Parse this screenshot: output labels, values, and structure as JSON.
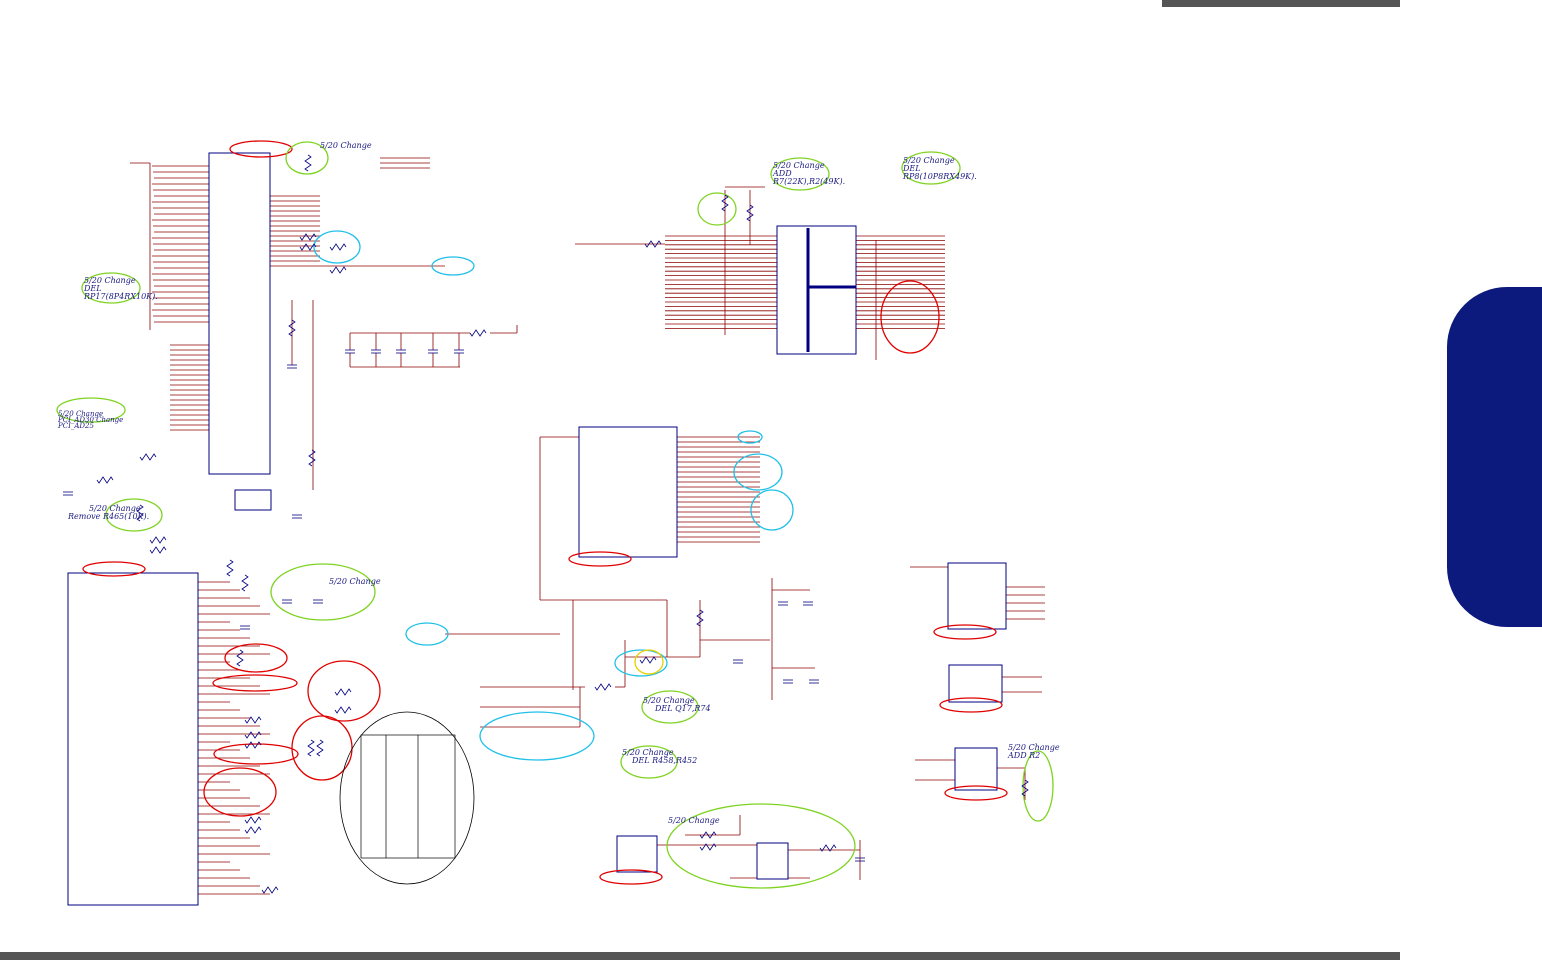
{
  "colors": {
    "wire": "#8b0000",
    "box": "#000080",
    "circle_red": "#e00000",
    "circle_green": "#7ed321",
    "circle_cyan": "#20c0e8",
    "circle_yellow": "#e8d000",
    "note": "#1a1a80",
    "side_tab": "#0d1a7d",
    "bar": "#555555"
  },
  "notes": {
    "n1": "5/20 Change",
    "n2a": "5/20 Change",
    "n2b": "ADD",
    "n2c": "R7(22K),R2(49K).",
    "n3a": "5/20 Change",
    "n3b": "DEL",
    "n3c": "RP8(10P8RX49K).",
    "n4a": "5/20 Change",
    "n4b": "DEL",
    "n4c": "RP17(8P4RX10K).",
    "n5a": "5/20 Change",
    "n5b": "PCI_AD30 Change",
    "n5c": "PCI_AD25",
    "n6a": "5/20 Change",
    "n6b": "Remove R465(10K).",
    "n7": "5/20 Change",
    "n8a": "5/20 Change",
    "n8b": "DEL Q17,R74",
    "n9a": "5/20 Change",
    "n9b": "DEL R458,R452",
    "n10": "5/20 Change",
    "n11a": "5/20 Change",
    "n11b": "ADD R2"
  }
}
